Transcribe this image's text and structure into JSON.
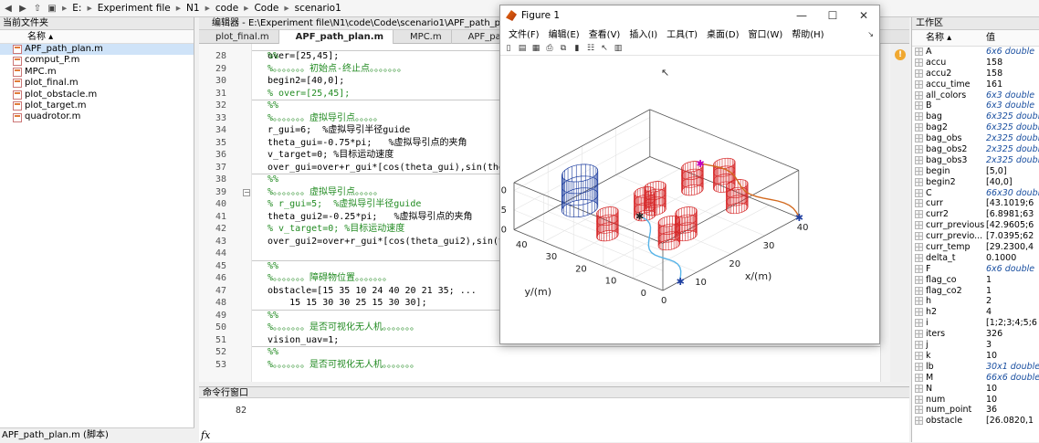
{
  "pathbar": {
    "crumbs": [
      "E:",
      "Experiment file",
      "N1",
      "code",
      "Code",
      "scenario1"
    ]
  },
  "left_panel": {
    "title": "当前文件夹",
    "column": "名称 ▴",
    "files": [
      {
        "name": "APF_path_plan.m",
        "selected": true
      },
      {
        "name": "comput_P.m",
        "selected": false
      },
      {
        "name": "MPC.m",
        "selected": false
      },
      {
        "name": "plot_final.m",
        "selected": false
      },
      {
        "name": "plot_obstacle.m",
        "selected": false
      },
      {
        "name": "plot_target.m",
        "selected": false
      },
      {
        "name": "quadrotor.m",
        "selected": false
      }
    ],
    "status": "APF_path_plan.m (脚本)"
  },
  "editor": {
    "title": "编辑器 - E:\\Experiment file\\N1\\code\\Code\\scenario1\\APF_path_plan.m",
    "tabs": [
      {
        "label": "plot_final.m",
        "active": false
      },
      {
        "label": "APF_path_plan.m",
        "active": true
      },
      {
        "label": "MPC.m",
        "active": false
      },
      {
        "label": "APF_path_pla...",
        "active": false
      }
    ],
    "lines": [
      {
        "n": "28",
        "text": "%%",
        "type": "com"
      },
      {
        "n": "29",
        "text": "%。。。。。。。初始点-终止点。。。。。。。",
        "type": "com"
      },
      {
        "n": "30",
        "text": "begin2=[40,0];",
        "type": "code"
      },
      {
        "n": "31",
        "text": "% over=[25,45];",
        "type": "com"
      },
      {
        "n": "32",
        "text": "%%",
        "type": "com"
      },
      {
        "n": "33",
        "text": "%。。。。。。。虚拟导引点。。。。。",
        "type": "com"
      },
      {
        "n": "34",
        "text": "r_gui=6;  %虚拟导引半径guide",
        "type": "code"
      },
      {
        "n": "35",
        "text": "theta_gui=-0.75*pi;   %虚拟导引点的夹角",
        "type": "code"
      },
      {
        "n": "36",
        "text": "v_target=0; %目标运动速度",
        "type": "code"
      },
      {
        "n": "37",
        "text": "over_gui=over+r_gui*[cos(theta_gui),sin(theta_gui)];",
        "type": "code"
      },
      {
        "n": "38",
        "text": "%%",
        "type": "com"
      },
      {
        "n": "39",
        "text": "%。。。。。。。虚拟导引点。。。。。",
        "type": "com"
      },
      {
        "n": "40",
        "text": "% r_gui=5;  %虚拟导引半径guide",
        "type": "com"
      },
      {
        "n": "41",
        "text": "theta_gui2=-0.25*pi;   %虚拟导引点的夹角",
        "type": "code"
      },
      {
        "n": "42",
        "text": "% v_target=0; %目标运动速度",
        "type": "com"
      },
      {
        "n": "43",
        "text": "over_gui2=over+r_gui*[cos(theta_gui2),sin(theta_gui2)];",
        "type": "code"
      },
      {
        "n": "44",
        "text": "",
        "type": "code"
      },
      {
        "n": "45",
        "text": "%%",
        "type": "com"
      },
      {
        "n": "46",
        "text": "%。。。。。。。障碍物位置。。。。。。。",
        "type": "com"
      },
      {
        "n": "47",
        "text": "obstacle=[15 35 10 24 40 20 21 35; ...",
        "type": "code"
      },
      {
        "n": "48",
        "text": "    15 15 30 30 25 15 30 30];",
        "type": "code"
      },
      {
        "n": "49",
        "text": "%%",
        "type": "com"
      },
      {
        "n": "50",
        "text": "%。。。。。。。是否可视化无人机。。。。。。。",
        "type": "com"
      },
      {
        "n": "51",
        "text": "vision_uav=1;",
        "type": "code"
      },
      {
        "n": "52",
        "text": "%%",
        "type": "com"
      },
      {
        "n": "53",
        "text": "%。。。。。。。是否可视化无人机。。。。。。。",
        "type": "com"
      }
    ],
    "partial_top_line": "over=[25,45];"
  },
  "command_window": {
    "title": "命令行窗口",
    "output": "82",
    "prompt": "fx"
  },
  "workspace": {
    "title": "工作区",
    "col_name": "名称 ▴",
    "col_value": "值",
    "vars": [
      {
        "name": "A",
        "value": "6x6 double",
        "italic": true
      },
      {
        "name": "accu",
        "value": "158",
        "italic": false
      },
      {
        "name": "accu2",
        "value": "158",
        "italic": false
      },
      {
        "name": "accu_time",
        "value": "161",
        "italic": false
      },
      {
        "name": "all_colors",
        "value": "6x3 double",
        "italic": true
      },
      {
        "name": "B",
        "value": "6x3 double",
        "italic": true
      },
      {
        "name": "bag",
        "value": "6x325 double",
        "italic": true
      },
      {
        "name": "bag2",
        "value": "6x325 double",
        "italic": true
      },
      {
        "name": "bag_obs",
        "value": "2x325 double",
        "italic": true
      },
      {
        "name": "bag_obs2",
        "value": "2x325 double",
        "italic": true
      },
      {
        "name": "bag_obs3",
        "value": "2x325 double",
        "italic": true
      },
      {
        "name": "begin",
        "value": "[5,0]",
        "italic": false
      },
      {
        "name": "begin2",
        "value": "[40,0]",
        "italic": false
      },
      {
        "name": "C",
        "value": "66x30 double",
        "italic": true
      },
      {
        "name": "curr",
        "value": "[43.1019;6",
        "italic": false
      },
      {
        "name": "curr2",
        "value": "[6.8981;63",
        "italic": false
      },
      {
        "name": "curr_previous",
        "value": "[42.9605;6",
        "italic": false
      },
      {
        "name": "curr_previo...",
        "value": "[7.0395;62",
        "italic": false
      },
      {
        "name": "curr_temp",
        "value": "[29.2300,4",
        "italic": false
      },
      {
        "name": "delta_t",
        "value": "0.1000",
        "italic": false
      },
      {
        "name": "F",
        "value": "6x6 double",
        "italic": true
      },
      {
        "name": "flag_co",
        "value": "1",
        "italic": false
      },
      {
        "name": "flag_co2",
        "value": "1",
        "italic": false
      },
      {
        "name": "h",
        "value": "2",
        "italic": false
      },
      {
        "name": "h2",
        "value": "4",
        "italic": false
      },
      {
        "name": "i",
        "value": "[1;2;3;4;5;6",
        "italic": false
      },
      {
        "name": "iters",
        "value": "326",
        "italic": false
      },
      {
        "name": "j",
        "value": "3",
        "italic": false
      },
      {
        "name": "k",
        "value": "10",
        "italic": false
      },
      {
        "name": "lb",
        "value": "30x1 double",
        "italic": true
      },
      {
        "name": "M",
        "value": "66x6 double",
        "italic": true
      },
      {
        "name": "N",
        "value": "10",
        "italic": false
      },
      {
        "name": "num",
        "value": "10",
        "italic": false
      },
      {
        "name": "num_point",
        "value": "36",
        "italic": false
      },
      {
        "name": "obstacle",
        "value": "[26.0820,1",
        "italic": false
      }
    ]
  },
  "figure": {
    "title": "Figure 1",
    "menus": [
      "文件(F)",
      "编辑(E)",
      "查看(V)",
      "插入(I)",
      "工具(T)",
      "桌面(D)",
      "窗口(W)",
      "帮助(H)"
    ],
    "win_controls": [
      "—",
      "☐",
      "✕"
    ],
    "xlabel": "x/(m)",
    "ylabel": "y/(m)",
    "zlabel": "z/(m)",
    "xticks": [
      "0",
      "10",
      "20",
      "30",
      "40"
    ],
    "yticks": [
      "0",
      "10",
      "20",
      "30",
      "40",
      "50"
    ],
    "zticks": [
      "0",
      "5",
      "10"
    ]
  },
  "colors": {
    "comment": "#228b22",
    "obstacle": "#d62728",
    "path1": "#56b4e9",
    "path2": "#d2691e",
    "tower": "#1f3fa0"
  }
}
